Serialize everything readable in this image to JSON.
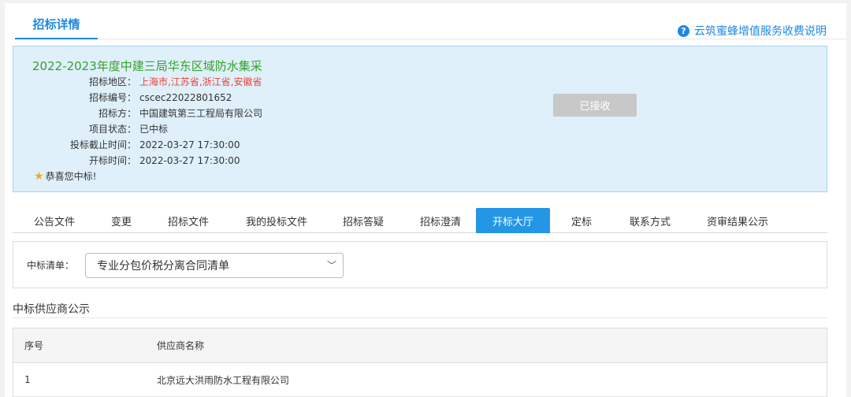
{
  "header": {
    "tab_title": "招标详情",
    "help_link": "云筑蜜蜂增值服务收费说明",
    "help_icon": "question-circle-icon"
  },
  "project": {
    "title": "2022-2023年度中建三局华东区域防水集采",
    "fields": [
      {
        "label": "招标地区：",
        "value": "上海市,江苏省,浙江省,安徽省"
      },
      {
        "label": "招标编号：",
        "value": "cscec22022801652"
      },
      {
        "label": "招标方：",
        "value": "中国建筑第三工程局有限公司"
      },
      {
        "label": "项目状态：",
        "value": "已中标"
      },
      {
        "label": "投标截止时间：",
        "value": "2022-03-27 17:30:00"
      },
      {
        "label": "开标时间：",
        "value": "2022-03-27 17:30:00"
      }
    ],
    "congrats": "恭喜您中标!",
    "status_button": "已接收",
    "region_color": "#e8453c"
  },
  "tabs": [
    {
      "label": "公告文件"
    },
    {
      "label": "变更"
    },
    {
      "label": "招标文件"
    },
    {
      "label": "我的投标文件"
    },
    {
      "label": "招标答疑"
    },
    {
      "label": "招标澄清"
    },
    {
      "label": "开标大厅"
    },
    {
      "label": "定标"
    },
    {
      "label": "联系方式"
    },
    {
      "label": "资审结果公示"
    }
  ],
  "active_tab": "开标大厅",
  "filter": {
    "label": "中标清单：",
    "selected": "专业分包价税分离合同清单"
  },
  "supplier_section": {
    "title": "中标供应商公示",
    "columns": [
      "序号",
      "供应商名称"
    ],
    "rows": [
      [
        "1",
        "北京远大洪雨防水工程有限公司"
      ]
    ]
  },
  "colors": {
    "accent": "#1e88e5",
    "active_tab": "#2496e6",
    "panel_bg": "#dff0fa",
    "title_green": "#35a12a"
  }
}
